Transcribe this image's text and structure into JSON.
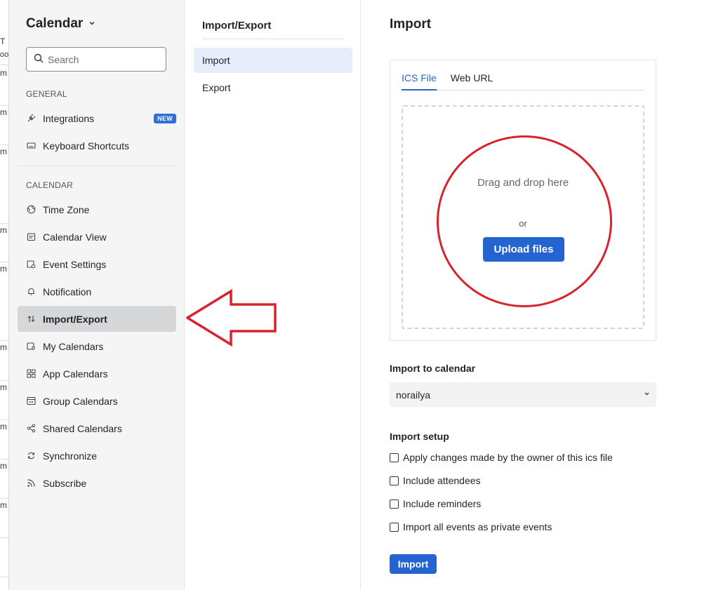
{
  "background_fragments": [
    "T",
    "oo",
    "m",
    "m",
    "m",
    "m",
    "m",
    "m",
    "m",
    "m",
    "m",
    "m"
  ],
  "sidebar": {
    "title": "Calendar",
    "search_placeholder": "Search",
    "general_label": "GENERAL",
    "general_items": [
      {
        "label": "Integrations",
        "icon": "plug-icon",
        "badge": "NEW"
      },
      {
        "label": "Keyboard Shortcuts",
        "icon": "keyboard-icon"
      }
    ],
    "calendar_label": "CALENDAR",
    "calendar_items": [
      {
        "label": "Time Zone",
        "icon": "globe-icon"
      },
      {
        "label": "Calendar View",
        "icon": "calendar-view-icon"
      },
      {
        "label": "Event Settings",
        "icon": "event-settings-icon"
      },
      {
        "label": "Notification",
        "icon": "bell-icon"
      },
      {
        "label": "Import/Export",
        "icon": "import-export-icon",
        "active": true
      },
      {
        "label": "My Calendars",
        "icon": "my-calendars-icon"
      },
      {
        "label": "App Calendars",
        "icon": "apps-grid-icon"
      },
      {
        "label": "Group Calendars",
        "icon": "group-calendar-icon"
      },
      {
        "label": "Shared Calendars",
        "icon": "share-icon"
      },
      {
        "label": "Synchronize",
        "icon": "sync-icon"
      },
      {
        "label": "Subscribe",
        "icon": "rss-icon"
      }
    ]
  },
  "middle": {
    "title": "Import/Export",
    "items": [
      {
        "label": "Import",
        "active": true
      },
      {
        "label": "Export"
      }
    ]
  },
  "main": {
    "title": "Import",
    "tabs": [
      {
        "label": "ICS File",
        "active": true
      },
      {
        "label": "Web URL"
      }
    ],
    "drop_text": "Drag and drop here",
    "or_text": "or",
    "upload_label": "Upload files",
    "import_to_label": "Import to calendar",
    "calendar_value": "norailya",
    "setup_label": "Import setup",
    "options": [
      {
        "label": "Apply changes made by the owner of this ics file",
        "checked": false
      },
      {
        "label": "Include attendees",
        "checked": false
      },
      {
        "label": "Include reminders",
        "checked": false
      },
      {
        "label": "Import all events as private events",
        "checked": false
      }
    ],
    "import_button": "Import"
  },
  "colors": {
    "accent": "#2563d1",
    "annotation_red": "#d8232f"
  }
}
